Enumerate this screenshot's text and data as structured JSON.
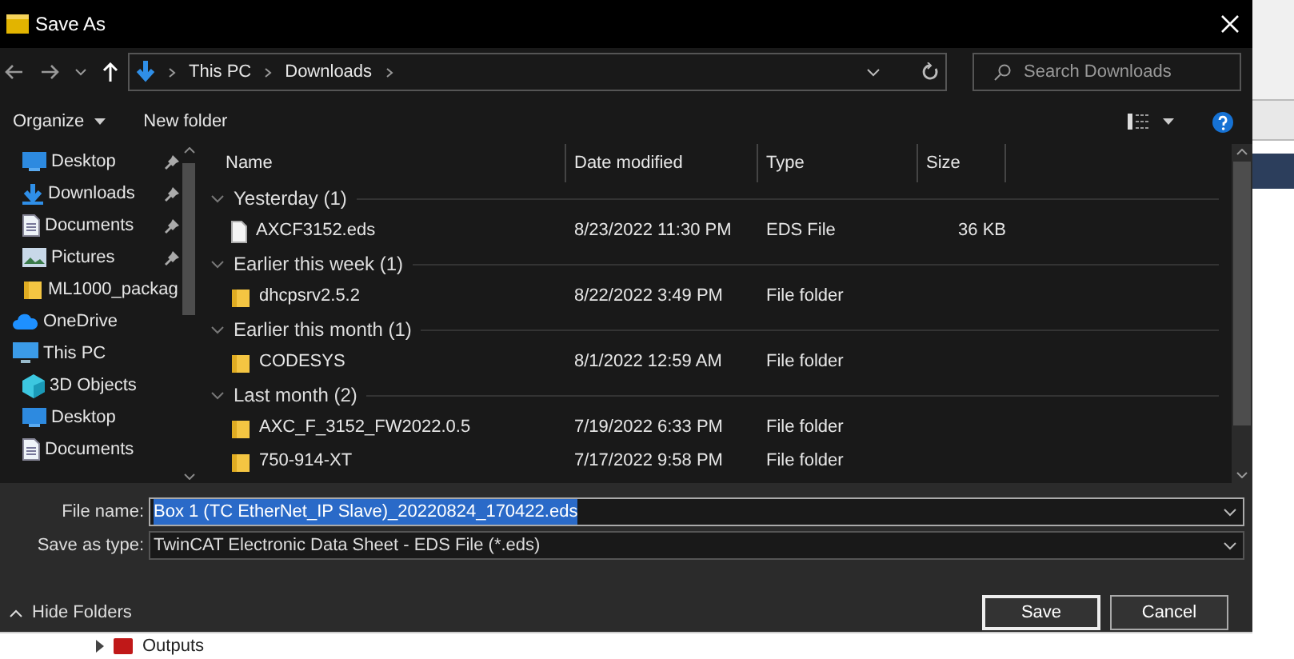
{
  "window": {
    "title": "Save As"
  },
  "address": {
    "crumbs": [
      "This PC",
      "Downloads"
    ],
    "search_placeholder": "Search Downloads"
  },
  "toolbar": {
    "organize": "Organize",
    "new_folder": "New folder"
  },
  "nav_pane": {
    "quick_access": [
      {
        "label": "Desktop",
        "kind": "desktop",
        "pinned": true
      },
      {
        "label": "Downloads",
        "kind": "download",
        "pinned": true
      },
      {
        "label": "Documents",
        "kind": "document",
        "pinned": true
      },
      {
        "label": "Pictures",
        "kind": "picture",
        "pinned": true
      },
      {
        "label": "ML1000_packag",
        "kind": "folder",
        "pinned": false
      }
    ],
    "locations": [
      {
        "label": "OneDrive",
        "kind": "cloud"
      },
      {
        "label": "This PC",
        "kind": "pc",
        "children": [
          {
            "label": "3D Objects",
            "kind": "cube"
          },
          {
            "label": "Desktop",
            "kind": "desktop"
          },
          {
            "label": "Documents",
            "kind": "document"
          }
        ]
      }
    ]
  },
  "table": {
    "columns": [
      "Name",
      "Date modified",
      "Type",
      "Size"
    ],
    "groups": [
      {
        "title": "Yesterday (1)",
        "rows": [
          {
            "name": "AXCF3152.eds",
            "kind": "file",
            "date": "8/23/2022 11:30 PM",
            "type": "EDS File",
            "size": "36 KB"
          }
        ]
      },
      {
        "title": "Earlier this week (1)",
        "rows": [
          {
            "name": "dhcpsrv2.5.2",
            "kind": "folder",
            "date": "8/22/2022 3:49 PM",
            "type": "File folder"
          }
        ]
      },
      {
        "title": "Earlier this month (1)",
        "rows": [
          {
            "name": "CODESYS",
            "kind": "folder",
            "date": "8/1/2022 12:59 AM",
            "type": "File folder"
          }
        ]
      },
      {
        "title": "Last month (2)",
        "rows": [
          {
            "name": "AXC_F_3152_FW2022.0.5",
            "kind": "folder",
            "date": "7/19/2022 6:33 PM",
            "type": "File folder"
          },
          {
            "name": "750-914-XT",
            "kind": "folder",
            "date": "7/17/2022 9:58 PM",
            "type": "File folder"
          }
        ]
      }
    ]
  },
  "form": {
    "file_name_label": "File name:",
    "file_name": "Box 1 (TC EtherNet_IP Slave)_20220824_170422.eds",
    "type_label": "Save as type:",
    "type_value": "TwinCAT Electronic Data Sheet - EDS File (*.eds)"
  },
  "hide_folders": "Hide Folders",
  "buttons": [
    "Save",
    "Cancel"
  ],
  "background_app": {
    "tree_item": "Outputs"
  }
}
